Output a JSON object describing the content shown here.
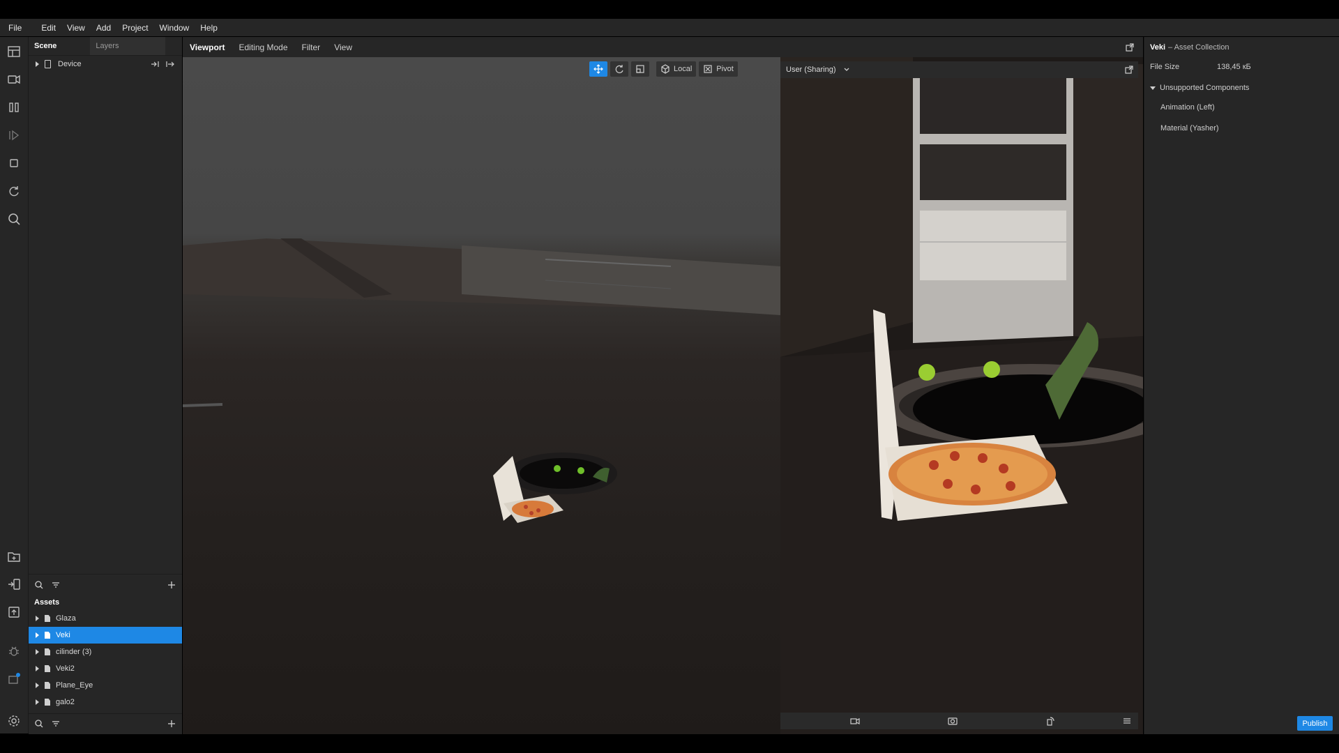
{
  "menu": [
    "File",
    "Edit",
    "View",
    "Add",
    "Project",
    "Window",
    "Help"
  ],
  "scene_panel": {
    "tab_scene": "Scene",
    "tab_layers": "Layers",
    "items": [
      {
        "label": "Device"
      }
    ]
  },
  "assets_panel": {
    "title": "Assets",
    "items": [
      {
        "label": "Glaza",
        "selected": false
      },
      {
        "label": "Veki",
        "selected": true
      },
      {
        "label": "cilinder (3)",
        "selected": false
      },
      {
        "label": "Veki2",
        "selected": false
      },
      {
        "label": "Plane_Eye",
        "selected": false
      },
      {
        "label": "galo2",
        "selected": false
      }
    ]
  },
  "viewport_tabs": [
    "Viewport",
    "Editing Mode",
    "Filter",
    "View"
  ],
  "viewport_toolbar": {
    "local": "Local",
    "pivot": "Pivot"
  },
  "preview": {
    "mode": "User (Sharing)"
  },
  "inspector": {
    "name": "Veki",
    "type": "– Asset Collection",
    "file_size_label": "File Size",
    "file_size_value": "138,45 кБ",
    "section": "Unsupported Components",
    "components": [
      "Animation (Left)",
      "Material (Yasher)"
    ]
  },
  "publish_label": "Publish",
  "colors": {
    "accent": "#1e88e5",
    "panel": "#262626"
  }
}
